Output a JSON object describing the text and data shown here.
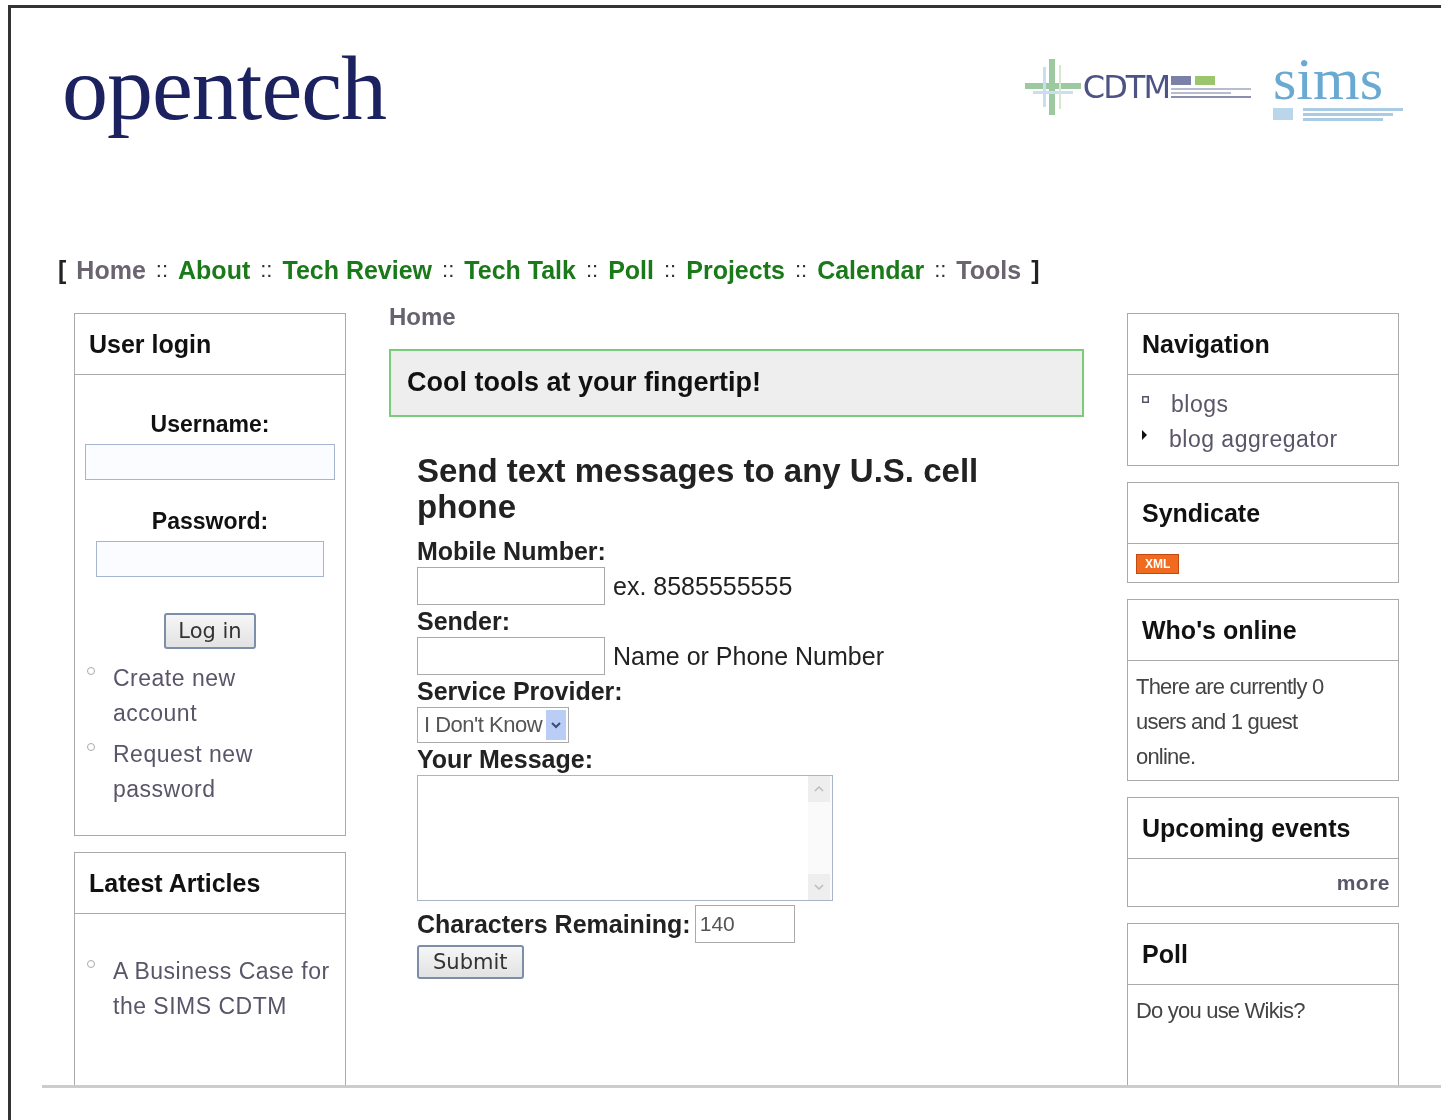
{
  "logo": {
    "text": "opentech"
  },
  "partner_logos": [
    {
      "kind": "cdtm",
      "text": "CDTM"
    },
    {
      "kind": "sims",
      "text": "sims"
    }
  ],
  "nav": {
    "open": "[",
    "close": "]",
    "items": [
      {
        "label": "Home",
        "visited": true
      },
      {
        "separator": "::",
        "label": "About",
        "visited": false
      },
      {
        "separator": "::",
        "label": "Tech Review",
        "visited": false
      },
      {
        "separator": "::",
        "label": "Tech Talk",
        "visited": false
      },
      {
        "separator": "::",
        "label": "Poll",
        "visited": false
      },
      {
        "separator": "::",
        "label": "Projects",
        "visited": false
      },
      {
        "separator": "::",
        "label": "Calendar",
        "visited": false
      },
      {
        "separator": "::",
        "label": "Tools",
        "visited": true
      }
    ]
  },
  "left_sidebar": {
    "user_login": {
      "title": "User login",
      "username_label": "Username:",
      "password_label": "Password:",
      "button": "Log in",
      "links": [
        "Create new account",
        "Request new password"
      ]
    },
    "latest_articles": {
      "title": "Latest Articles",
      "items": [
        "A Business Case for the SIMS CDTM"
      ]
    }
  },
  "main": {
    "breadcrumb": "Home",
    "banner": "Cool tools at your fingertip!",
    "form": {
      "heading": "Send text messages to any U.S. cell phone",
      "mobile_label": "Mobile Number:",
      "mobile_hint": "ex. 8585555555",
      "sender_label": "Sender:",
      "sender_hint": "Name or Phone Number",
      "provider_label": "Service Provider:",
      "provider_value": "I Don't Know",
      "message_label": "Your Message:",
      "remaining_label": "Characters Remaining:",
      "remaining_value": "140",
      "submit": "Submit"
    }
  },
  "right_sidebar": [
    {
      "kind": "menu",
      "title": "Navigation",
      "items": [
        {
          "label": "blogs",
          "expandable": false
        },
        {
          "label": "blog aggregator",
          "expandable": true
        }
      ]
    },
    {
      "kind": "feed",
      "title": "Syndicate",
      "badge": "XML"
    },
    {
      "kind": "text",
      "title": "Who's online",
      "text": "There are currently 0 users and 1 guest online."
    },
    {
      "kind": "more",
      "title": "Upcoming events",
      "link": "more"
    },
    {
      "kind": "text",
      "title": "Poll",
      "text": "Do you use Wikis?"
    }
  ]
}
